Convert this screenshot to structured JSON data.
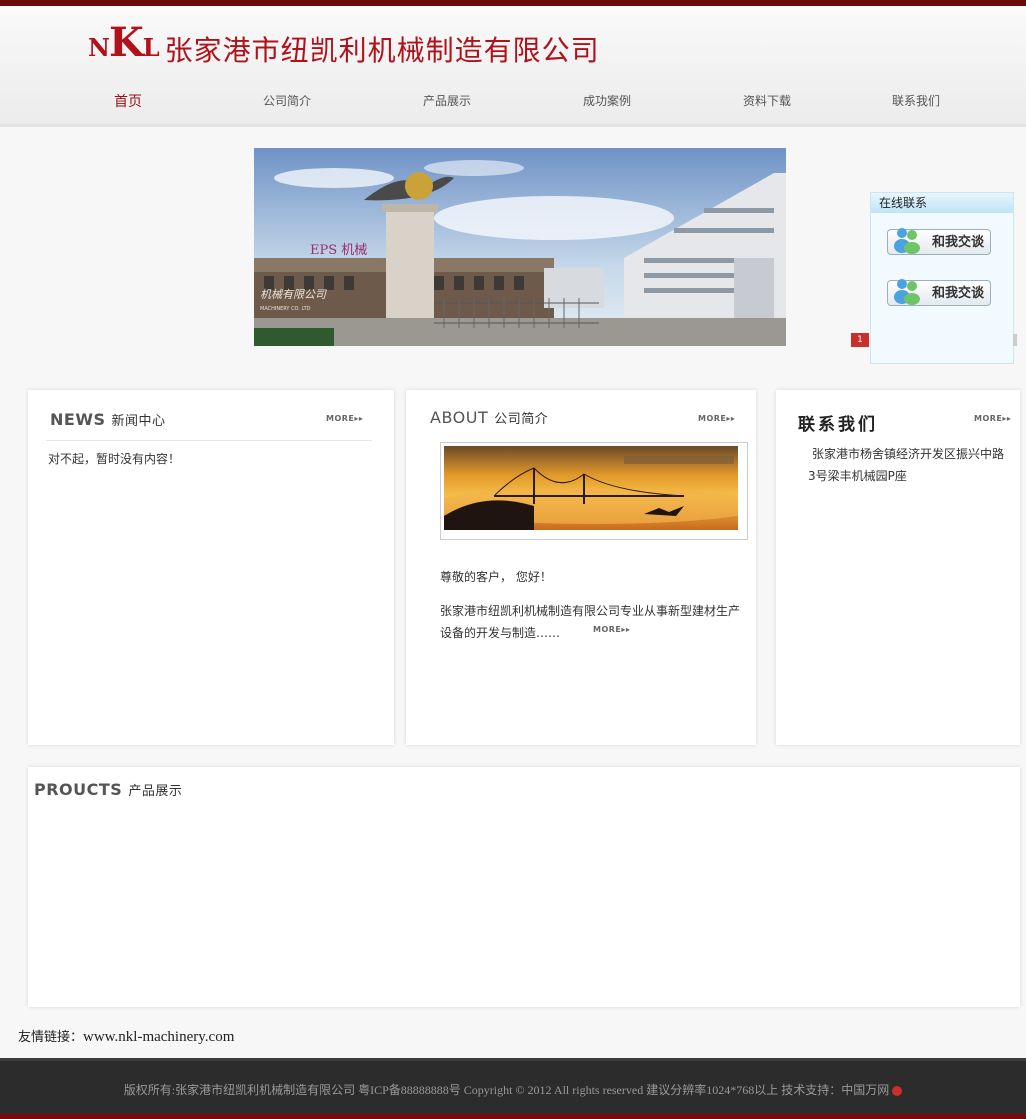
{
  "header": {
    "logo_mark_big_n": "N",
    "logo_mark_k": "K",
    "logo_mark_l": "L",
    "company_name": "张家港市纽凯利机械制造有限公司"
  },
  "nav": {
    "items": [
      {
        "label": "首页"
      },
      {
        "label": "公司简介"
      },
      {
        "label": "产品展示"
      },
      {
        "label": "成功案例"
      },
      {
        "label": "资料下载"
      },
      {
        "label": "联系我们"
      }
    ]
  },
  "banner": {
    "sign_text": "EPS 机械",
    "wall_text": "机械有限公司",
    "wall_subtext": "MACHINERY CO. LTD"
  },
  "online_chat": {
    "title": "在线联系",
    "button1": "和我交谈",
    "button2": "和我交谈",
    "slide_index": "1"
  },
  "news": {
    "title_en": "NEWS",
    "title_cn": "新闻中心",
    "more": "MORE▸▸",
    "empty_text": "对不起，暂时没有内容！"
  },
  "about": {
    "title_en": "ABOUT",
    "title_cn": "公司简介",
    "more": "MORE▸▸",
    "greeting": "尊敬的客户，  您好！",
    "intro": "张家港市纽凯利机械制造有限公司专业从事新型建材生产设备的开发与制造……",
    "inline_more": "MORE▸▸"
  },
  "contact": {
    "title": "联系我们",
    "more": "MORE▸▸",
    "address": "张家港市杨舍镇经济开发区振兴中路3号梁丰机械园P座"
  },
  "products": {
    "title_en": "PROUCTS",
    "title_cn": "产品展示"
  },
  "links": {
    "label": "友情链接：",
    "url": "www.nkl-machinery.com"
  },
  "footer": {
    "text": "版权所有:张家港市纽凯利机械制造有限公司 粤ICP备88888888号 Copyright © 2012 All rights reserved 建议分辨率1024*768以上 技术支持：中国万网"
  },
  "colors": {
    "brand_red": "#b1121a",
    "nav_active": "#9b0f14",
    "footer_bg": "#2c2c2c"
  }
}
